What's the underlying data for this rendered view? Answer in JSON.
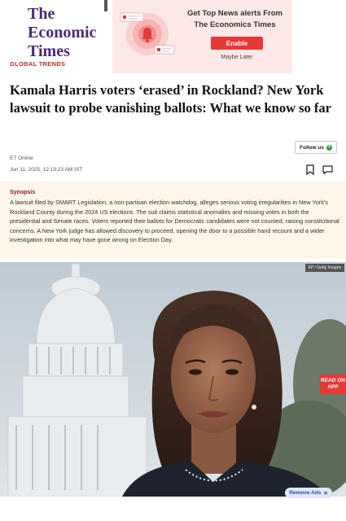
{
  "header": {
    "logo_lines": [
      "The",
      "Economic",
      "Times"
    ],
    "section": "GLOBAL TRENDS"
  },
  "alert": {
    "title": "Get Top News alerts From The Economics Times",
    "enable_label": "Enable",
    "maybe_later_label": "Maybe Later",
    "icon": "bell-icon"
  },
  "article": {
    "headline": "Kamala Harris voters ‘erased’ in Rockland? New York lawsuit to probe vanishing ballots: What we know so far",
    "follow_label": "Follow us",
    "byline": "ET Online",
    "date": "Jun 11, 2025, 12:19:23 AM IST",
    "icons": [
      "bookmark-icon",
      "comment-icon"
    ]
  },
  "synopsis": {
    "label": "Synopsis",
    "text": "A lawsuit filed by SMART Legislation, a non-partisan election watchdog, alleges serious voting irregularities in New York's Rockland County during the 2024 US elections. The suit claims statistical anomalies and missing votes in both the presidential and Senate races. Voters reported their ballots for Democratic candidates were not counted, raising constitutional concerns. A New York judge has allowed discovery to proceed, opening the door to a possible hand recount and a wider investigation into what may have gone wrong on Election Day."
  },
  "image": {
    "credit": "AP / Getty Images",
    "read_on_app": "READ ON APP"
  },
  "ads": {
    "remove_label": "Remove Ads"
  },
  "colors": {
    "logo": "#4a2a7a",
    "accent_red": "#e53935",
    "synopsis_bg": "#fdf6e9",
    "alert_bg": "#fde8e8"
  }
}
